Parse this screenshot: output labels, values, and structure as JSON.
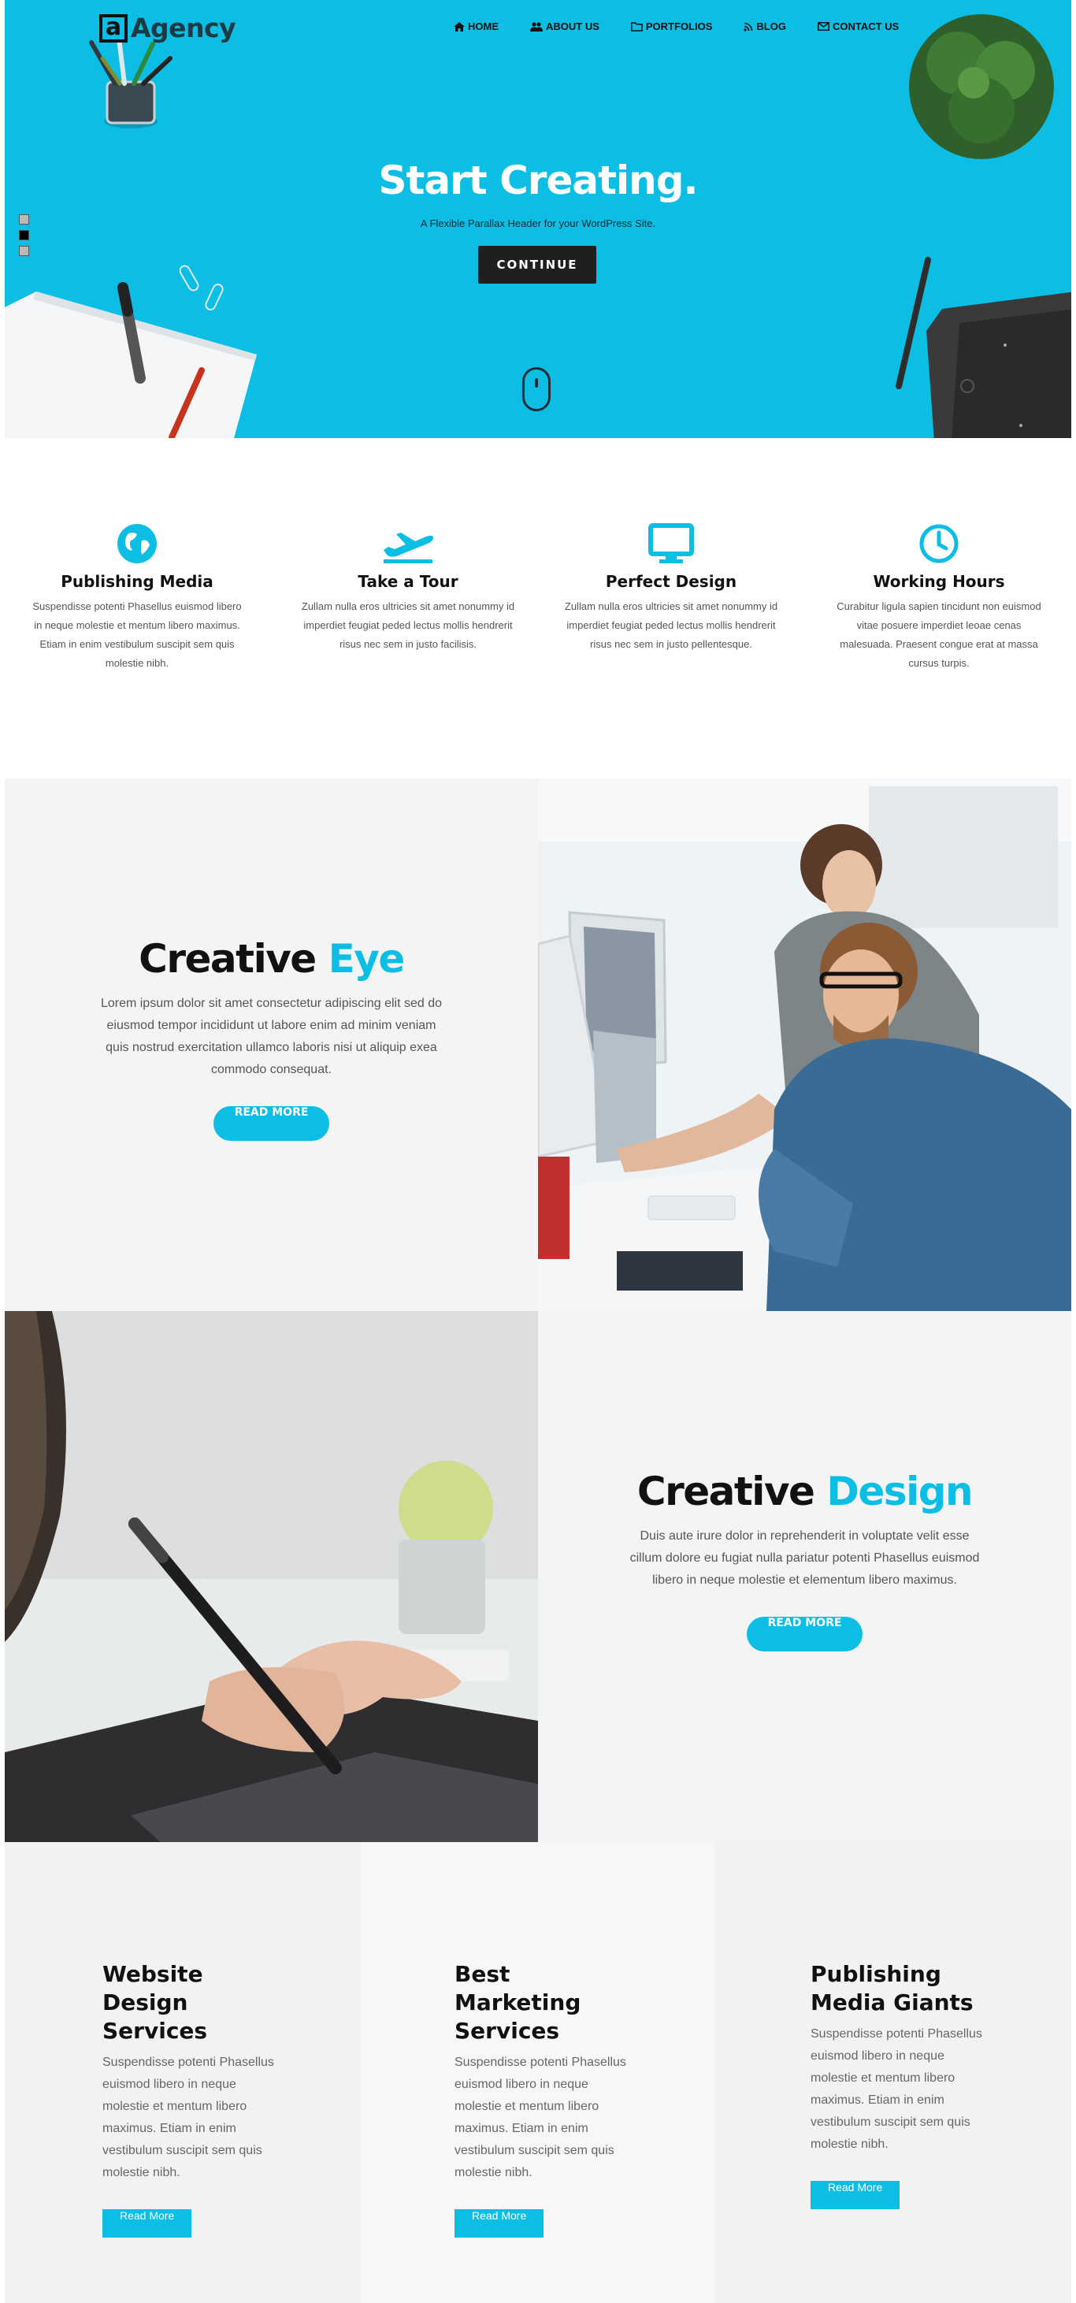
{
  "brand": {
    "mark": "a",
    "name": "Agency"
  },
  "nav": [
    {
      "label": "HOME",
      "icon": "home-icon"
    },
    {
      "label": "ABOUT US",
      "icon": "users-icon"
    },
    {
      "label": "PORTFOLIOS",
      "icon": "folder-icon"
    },
    {
      "label": "BLOG",
      "icon": "rss-icon"
    },
    {
      "label": "CONTACT US",
      "icon": "envelope-icon"
    }
  ],
  "hero": {
    "title": "Start Creating.",
    "subtitle": "A Flexible Parallax Header for your WordPress Site.",
    "button": "CONTINUE",
    "background": "#0cbee4",
    "slides": 3,
    "active_slide": 2
  },
  "features": [
    {
      "icon": "globe-icon",
      "title": "Publishing Media",
      "text": "Suspendisse potenti Phasellus euismod libero in neque molestie et mentum libero maximus. Etiam in enim vestibulum suscipit sem quis molestie nibh."
    },
    {
      "icon": "plane-icon",
      "title": "Take a Tour",
      "text": "Zullam nulla eros ultricies sit amet nonummy id imperdiet feugiat peded lectus mollis hendrerit risus nec sem in justo facilisis."
    },
    {
      "icon": "monitor-icon",
      "title": "Perfect Design",
      "text": "Zullam nulla eros ultricies sit amet nonummy id imperdiet feugiat peded lectus mollis hendrerit risus nec sem in justo pellentesque."
    },
    {
      "icon": "clock-icon",
      "title": "Working Hours",
      "text": "Curabitur ligula sapien tincidunt non euismod vitae posuere imperdiet leoae cenas malesuada. Praesent congue erat at massa cursus turpis."
    }
  ],
  "creative_eye": {
    "title_main": "Creative",
    "title_accent": "Eye",
    "text": "Lorem ipsum dolor sit amet consectetur adipiscing elit sed do eiusmod tempor incididunt ut labore enim ad minim veniam quis nostrud exercitation ullamco laboris nisi ut aliquip exea commodo consequat.",
    "button": "READ MORE"
  },
  "creative_design": {
    "title_main": "Creative",
    "title_accent": "Design",
    "text": "Duis aute irure dolor in reprehenderit in voluptate velit esse cillum dolore eu fugiat nulla pariatur potenti Phasellus euismod libero in neque molestie et elementum libero maximus.",
    "button": "READ MORE"
  },
  "services": [
    {
      "title": "Website Design Services",
      "text": "Suspendisse potenti Phasellus euismod libero in neque molestie et mentum libero maximus. Etiam in enim vestibulum suscipit sem quis molestie nibh.",
      "button": "Read More"
    },
    {
      "title": "Best Marketing Services",
      "text": "Suspendisse potenti Phasellus euismod libero in neque molestie et mentum libero maximus. Etiam in enim vestibulum suscipit sem quis molestie nibh.",
      "button": "Read More"
    },
    {
      "title": "Publishing Media Giants",
      "text": "Suspendisse potenti Phasellus euismod libero in neque molestie et mentum libero maximus. Etiam in enim vestibulum suscipit sem quis molestie nibh.",
      "button": "Read More"
    }
  ],
  "colors": {
    "accent": "#0cbee4",
    "dark": "#1f1f1f",
    "panel": "#f4f4f4"
  }
}
